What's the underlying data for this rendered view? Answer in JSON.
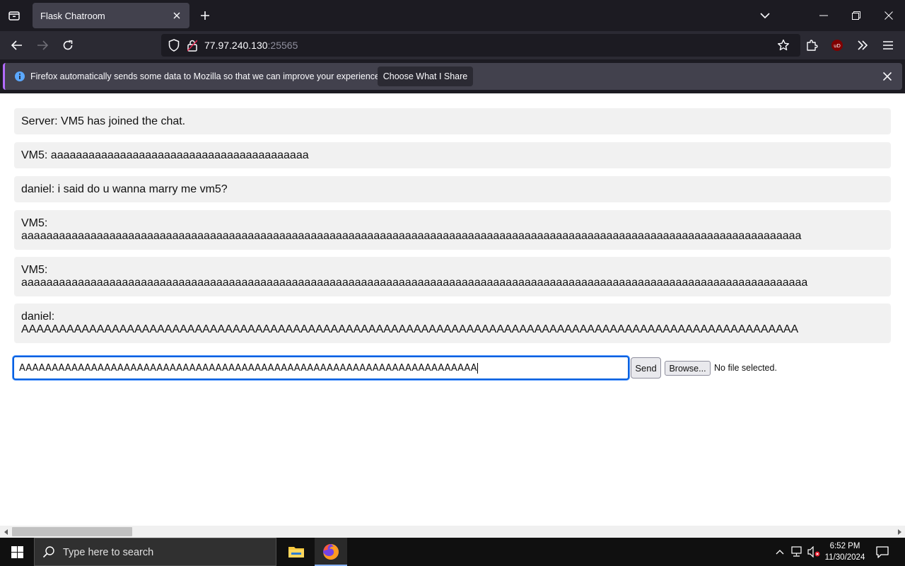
{
  "browser": {
    "tab_title": "Flask Chatroom",
    "url_host": "77.97.240.130",
    "url_port": ":25565",
    "ublock_badge": "uD"
  },
  "notification": {
    "text": "Firefox automatically sends some data to Mozilla so that we can improve your experience.",
    "button_label": "Choose What I Share"
  },
  "chat": {
    "messages": [
      {
        "text": "Server: VM5 has joined the chat."
      },
      {
        "text": "VM5: aaaaaaaaaaaaaaaaaaaaaaaaaaaaaaaaaaaaaaaaa"
      },
      {
        "text": "daniel: i said do u wanna marry me vm5?"
      },
      {
        "sender": "VM5:",
        "text": "aaaaaaaaaaaaaaaaaaaaaaaaaaaaaaaaaaaaaaaaaaaaaaaaaaaaaaaaaaaaaaaaaaaaaaaaaaaaaaaaaaaaaaaaaaaaaaaaaaaaaaaaaaaaaaaaaaaaaaaaaaaa"
      },
      {
        "sender": "VM5:",
        "text": "aaaaaaaaaaaaaaaaaaaaaaaaaaaaaaaaaaaaaaaaaaaaaaaaaaaaaaaaaaaaaaaaaaaaaaaaaaaaaaaaaaaaaaaaaaaaaaaaaaaaaaaaaaaaaaaaaaaaaaaaaaaaa"
      },
      {
        "sender": "daniel:",
        "text": "AAAAAAAAAAAAAAAAAAAAAAAAAAAAAAAAAAAAAAAAAAAAAAAAAAAAAAAAAAAAAAAAAAAAAAAAAAAAAAAAAAAAAAAAAAAAAAAAAAAAAAA"
      }
    ],
    "input_value": "AAAAAAAAAAAAAAAAAAAAAAAAAAAAAAAAAAAAAAAAAAAAAAAAAAAAAAAAAAAAAAAAAAAAAA",
    "send_label": "Send",
    "browse_label": "Browse...",
    "file_status": "No file selected."
  },
  "taskbar": {
    "search_placeholder": "Type here to search",
    "time": "6:52 PM",
    "date": "11/30/2024"
  },
  "colors": {
    "tab_bg": "#42414d",
    "toolbar_bg": "#2b2a33",
    "message_bg": "#f1f1f1",
    "focus_ring": "#0060df"
  }
}
